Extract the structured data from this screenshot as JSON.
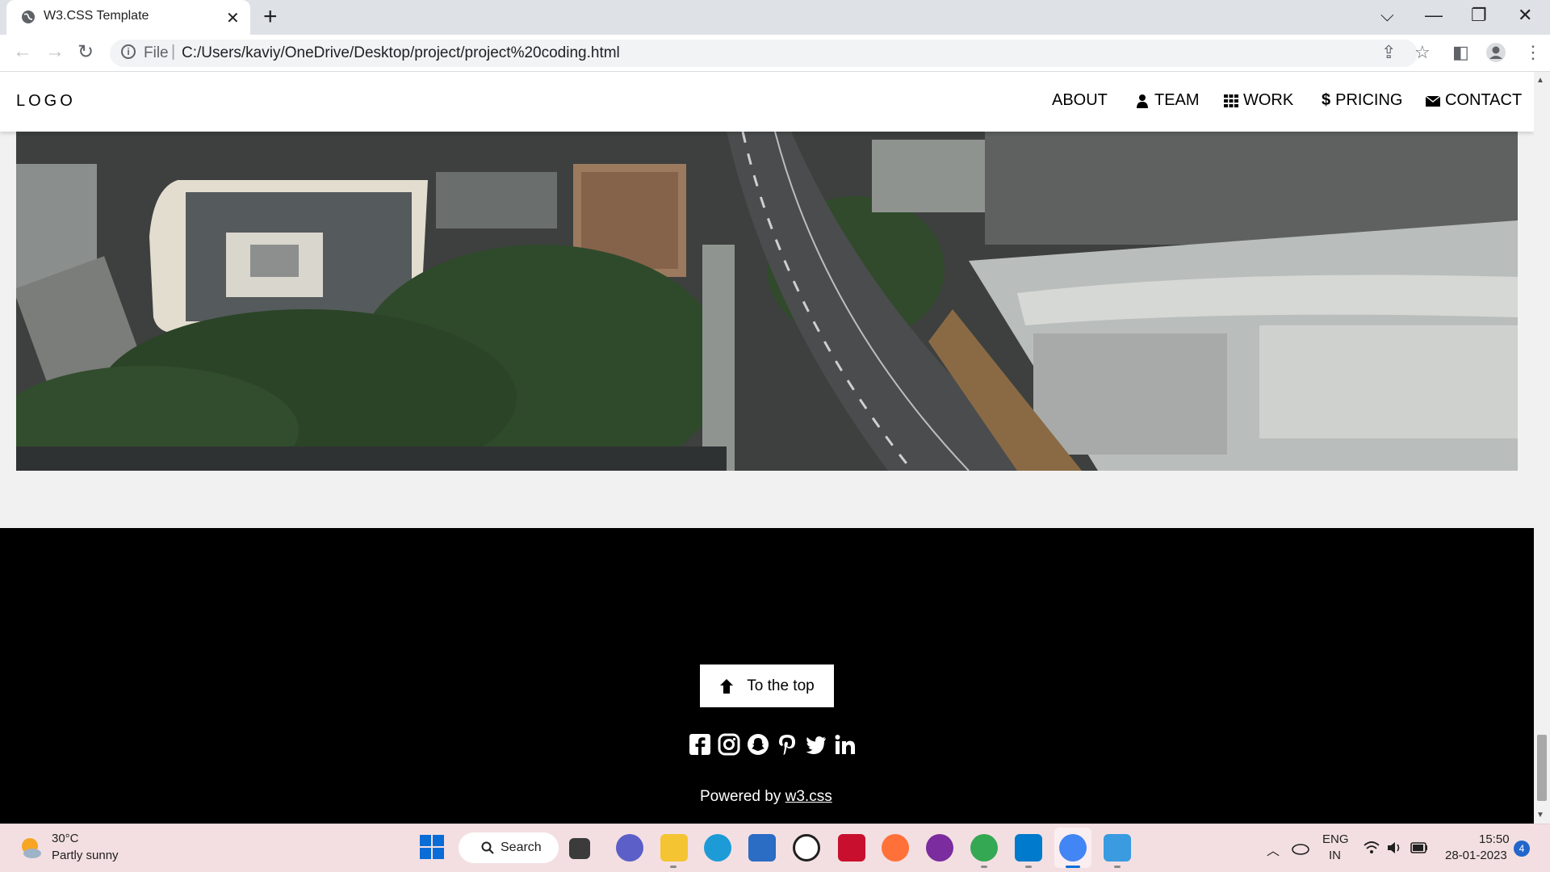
{
  "browser": {
    "tab_title": "W3.CSS Template",
    "tab_close": "✕",
    "new_tab": "+",
    "scheme": "File",
    "separator": "|",
    "url": "C:/Users/kaviy/OneDrive/Desktop/project/project%20coding.html",
    "info_icon": "i",
    "window_controls": {
      "dropdown": "⌵",
      "minimize": "—",
      "restore": "❐",
      "close": "✕"
    },
    "nav": {
      "back": "←",
      "forward": "→",
      "reload": "↻"
    },
    "toolbar_icons": {
      "share": "⇪",
      "bookmark": "☆",
      "sidepanel": "◧",
      "menu": "⋮"
    }
  },
  "page": {
    "logo": "LOGO",
    "nav": [
      {
        "label": "ABOUT",
        "icon": ""
      },
      {
        "label": "TEAM",
        "icon": "user-icon"
      },
      {
        "label": "WORK",
        "icon": "grid-icon"
      },
      {
        "label": "PRICING",
        "icon": "dollar-icon"
      },
      {
        "label": "CONTACT",
        "icon": "envelope-icon"
      }
    ],
    "hero_alt": "Aerial city view",
    "footer": {
      "to_top": "To the top",
      "powered_prefix": "Powered by ",
      "powered_link": "w3.css",
      "social": [
        "facebook-icon",
        "instagram-icon",
        "snapchat-icon",
        "pinterest-icon",
        "twitter-icon",
        "linkedin-icon"
      ]
    }
  },
  "taskbar": {
    "temperature": "30°C",
    "condition": "Partly sunny",
    "search_label": "Search",
    "lang_line1": "ENG",
    "lang_line2": "IN",
    "time": "15:50",
    "date": "28-01-2023",
    "notification_count": "4",
    "apps": [
      "task-view-icon",
      "teams-chat-icon",
      "file-explorer-icon",
      "edge-icon",
      "store-icon",
      "dell-icon",
      "mcafee-icon",
      "firefox-icon",
      "game-icon",
      "chrome-icon",
      "vscode-icon",
      "chrome-active-icon",
      "photos-icon"
    ]
  }
}
